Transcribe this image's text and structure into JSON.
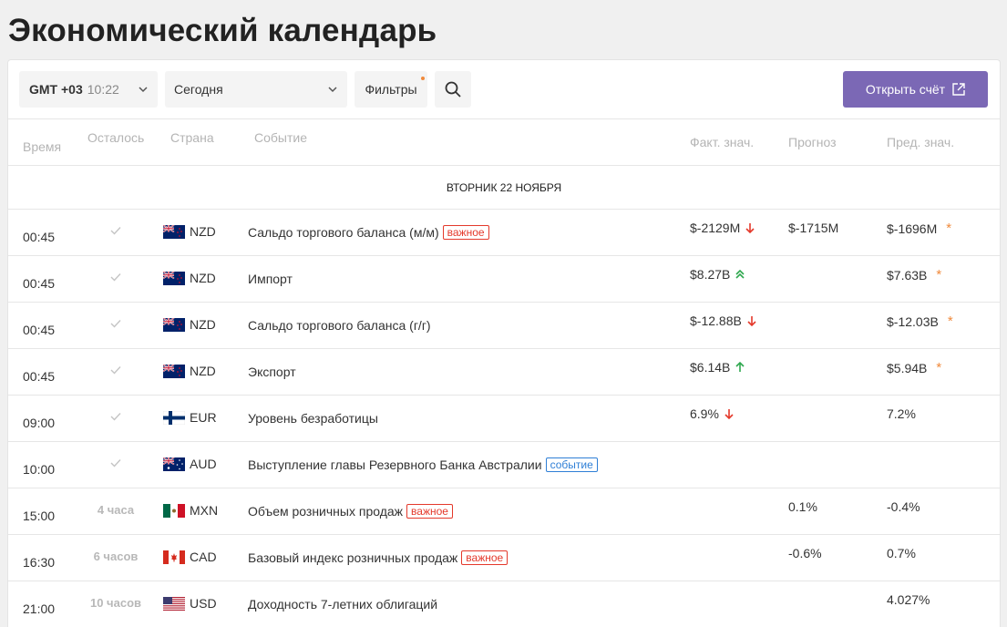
{
  "page": {
    "title": "Экономический календарь"
  },
  "toolbar": {
    "timezone_label": "GMT +03",
    "timezone_time": "10:22",
    "date_value": "Сегодня",
    "filters_label": "Фильтры",
    "open_account_label": "Открыть счёт"
  },
  "table": {
    "headers": {
      "time": "Время",
      "left": "Осталось",
      "country": "Страна",
      "event": "Событие",
      "actual": "Факт. знач.",
      "forecast": "Прогноз",
      "previous": "Пред. знач."
    },
    "day_label": "ВТОРНИК 22 НОЯБРЯ",
    "rows": [
      {
        "time": "00:45",
        "left": "",
        "done": true,
        "flag": "nz",
        "currency": "NZD",
        "event": "Сальдо торгового баланса (м/м)",
        "badge": "важное",
        "badge_type": "imp",
        "actual": "$-2129M",
        "trend": "down",
        "forecast": "$-1715M",
        "previous": "$-1696M",
        "revised": true
      },
      {
        "time": "00:45",
        "left": "",
        "done": true,
        "flag": "nz",
        "currency": "NZD",
        "event": "Импорт",
        "badge": "",
        "badge_type": "",
        "actual": "$8.27B",
        "trend": "up2",
        "forecast": "",
        "previous": "$7.63B",
        "revised": true
      },
      {
        "time": "00:45",
        "left": "",
        "done": true,
        "flag": "nz",
        "currency": "NZD",
        "event": "Сальдо торгового баланса (г/г)",
        "badge": "",
        "badge_type": "",
        "actual": "$-12.88B",
        "trend": "down",
        "forecast": "",
        "previous": "$-12.03B",
        "revised": true
      },
      {
        "time": "00:45",
        "left": "",
        "done": true,
        "flag": "nz",
        "currency": "NZD",
        "event": "Экспорт",
        "badge": "",
        "badge_type": "",
        "actual": "$6.14B",
        "trend": "up",
        "forecast": "",
        "previous": "$5.94B",
        "revised": true
      },
      {
        "time": "09:00",
        "left": "",
        "done": true,
        "flag": "fi",
        "currency": "EUR",
        "event": "Уровень безработицы",
        "badge": "",
        "badge_type": "",
        "actual": "6.9%",
        "trend": "down",
        "forecast": "",
        "previous": "7.2%",
        "revised": false
      },
      {
        "time": "10:00",
        "left": "",
        "done": true,
        "flag": "au",
        "currency": "AUD",
        "event": "Выступление главы Резервного Банка Австралии",
        "badge": "событие",
        "badge_type": "evt",
        "actual": "",
        "trend": "",
        "forecast": "",
        "previous": "",
        "revised": false
      },
      {
        "time": "15:00",
        "left": "4 часа",
        "done": false,
        "flag": "mx",
        "currency": "MXN",
        "event": "Объем розничных продаж",
        "badge": "важное",
        "badge_type": "imp",
        "actual": "",
        "trend": "",
        "forecast": "0.1%",
        "previous": "-0.4%",
        "revised": false
      },
      {
        "time": "16:30",
        "left": "6 часов",
        "done": false,
        "flag": "ca",
        "currency": "CAD",
        "event": "Базовый индекс розничных продаж",
        "badge": "важное",
        "badge_type": "imp",
        "actual": "",
        "trend": "",
        "forecast": "-0.6%",
        "previous": "0.7%",
        "revised": false
      },
      {
        "time": "21:00",
        "left": "10 часов",
        "done": false,
        "flag": "us",
        "currency": "USD",
        "event": "Доходность 7-летних облигаций",
        "badge": "",
        "badge_type": "",
        "actual": "",
        "trend": "",
        "forecast": "",
        "previous": "4.027%",
        "revised": false
      }
    ]
  },
  "colors": {
    "accent": "#7b68b5",
    "important": "#e4392b",
    "event": "#2f7fd6",
    "down": "#e4392b",
    "up": "#2fa84f",
    "revised_star": "#f08a3c"
  }
}
